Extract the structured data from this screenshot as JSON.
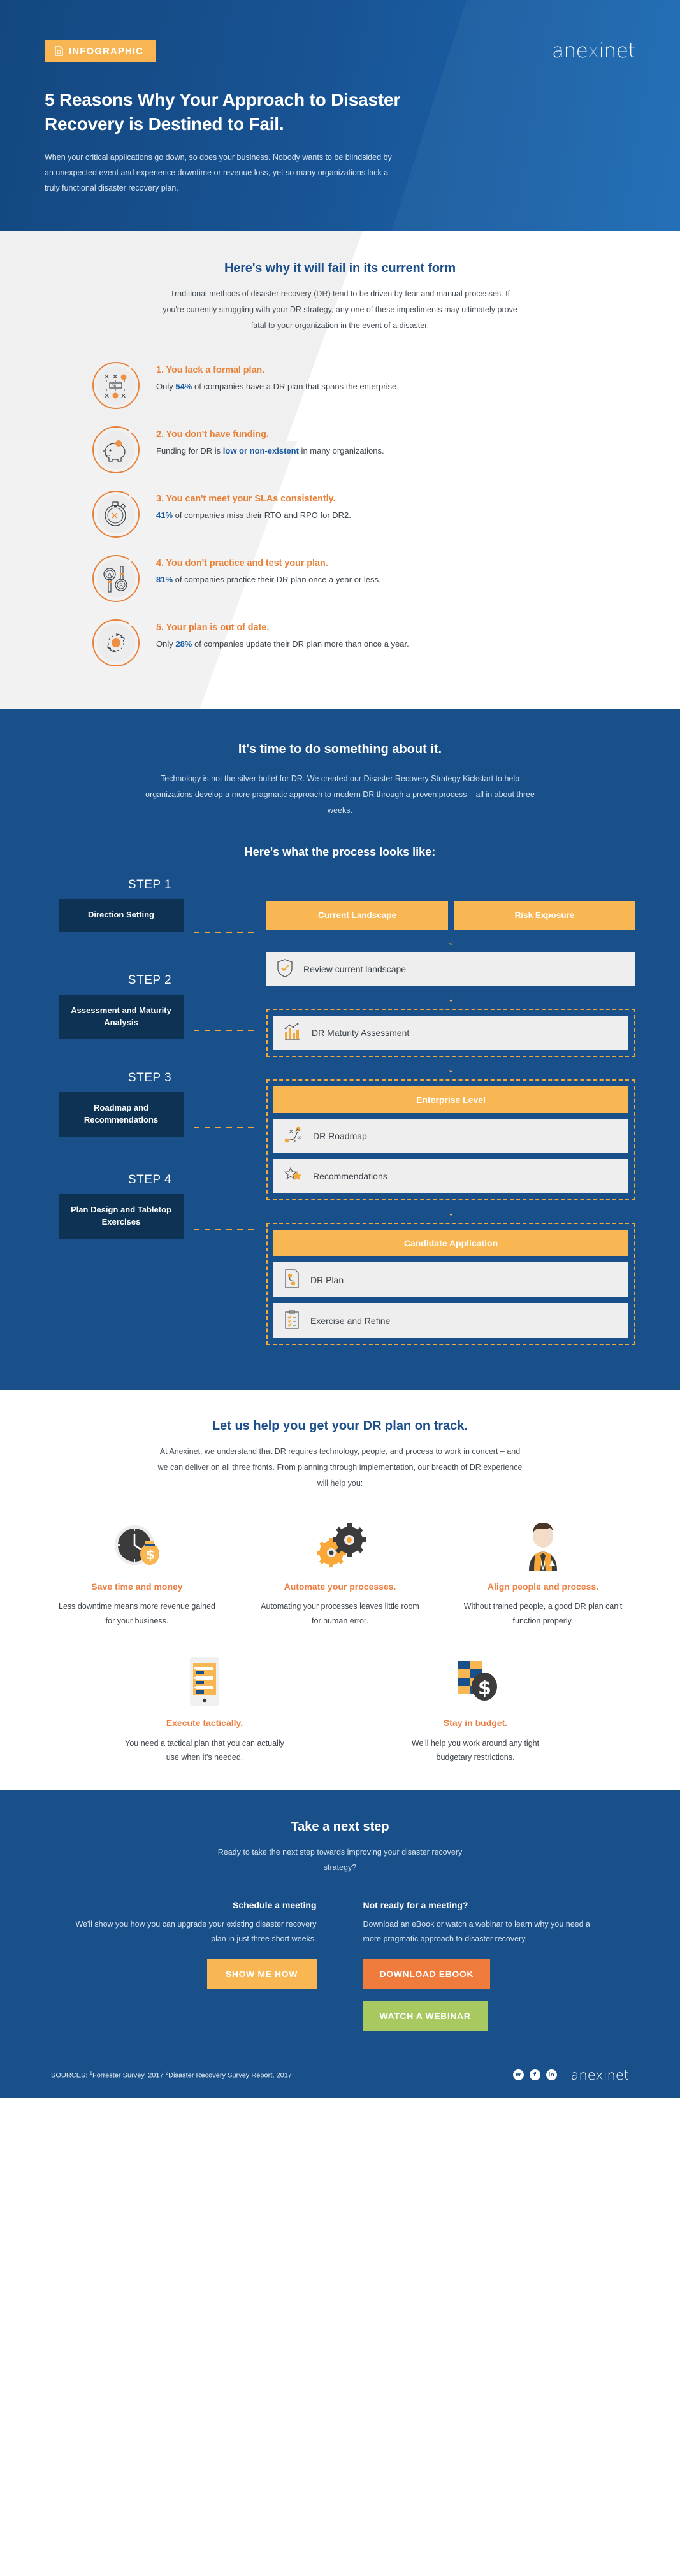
{
  "hero": {
    "badge_label": "INFOGRAPHIC",
    "badge_icon": "document-icon",
    "logo": "anexinet",
    "headline": "5 Reasons Why Your Approach to Disaster Recovery is Destined to Fail.",
    "paragraph": "When your critical applications go down, so does your business. Nobody wants to be blindsided by an unexpected event and experience downtime or revenue loss, yet so many organizations lack a truly functional disaster recovery plan."
  },
  "why": {
    "heading": "Here's why it will fail in its current form",
    "lede": "Traditional methods of disaster recovery (DR) tend to be driven by fear and manual processes. If you're currently struggling with your DR strategy, any one of these impediments may ultimately prove fatal to your organization in the event of a disaster.",
    "reasons": [
      {
        "title": "1. You lack a formal plan.",
        "body_pre": "Only ",
        "stat": "54%",
        "body_post": " of companies have a DR plan that spans the enterprise.",
        "icon": "strategy-board-icon"
      },
      {
        "title": "2. You don't have funding.",
        "body_pre": "Funding for DR is ",
        "stat": "low or non-existent",
        "body_post": " in many organizations.",
        "icon": "piggy-bank-icon"
      },
      {
        "title": "3. You can't meet your SLAs consistently.",
        "body_pre": "",
        "stat": "41%",
        "body_post": " of companies miss their RTO and RPO for DR2.",
        "icon": "stopwatch-icon"
      },
      {
        "title": "4. You don't practice and test your plan.",
        "body_pre": "",
        "stat": "81%",
        "body_post": " of companies practice their DR plan once a year or less.",
        "icon": "ab-test-icon"
      },
      {
        "title": "5. Your plan is out of date.",
        "body_pre": "Only ",
        "stat": "28%",
        "body_post": " of companies update their DR plan more than once a year.",
        "icon": "refresh-cycle-icon"
      }
    ]
  },
  "process": {
    "heading": "It's time to do something about it.",
    "lede": "Technology is not the silver bullet for DR. We created our Disaster Recovery Strategy Kickstart to help organizations develop a more pragmatic approach to modern DR through a proven process – all in about three weeks.",
    "subheading": "Here's what the process looks like:",
    "steps": [
      {
        "label": "STEP 1",
        "box": "Direction Setting"
      },
      {
        "label": "STEP 2",
        "box": "Assessment and Maturity Analysis"
      },
      {
        "label": "STEP 3",
        "box": "Roadmap and Recommendations"
      },
      {
        "label": "STEP 4",
        "box": "Plan Design and Tabletop Exercises"
      }
    ],
    "flow": {
      "s1_cell_a": "Current Landscape",
      "s1_cell_b": "Risk Exposure",
      "s1_card": "Review current landscape",
      "s1_card_icon": "shield-check-icon",
      "s2_card": "DR Maturity Assessment",
      "s2_card_icon": "bar-chart-icon",
      "s3_banner": "Enterprise Level",
      "s3_card_a": "DR Roadmap",
      "s3_card_a_icon": "roadmap-icon",
      "s3_card_b": "Recommendations",
      "s3_card_b_icon": "stars-icon",
      "s4_banner": "Candidate Application",
      "s4_card_a": "DR Plan",
      "s4_card_a_icon": "plan-document-icon",
      "s4_card_b": "Exercise and Refine",
      "s4_card_b_icon": "checklist-icon"
    }
  },
  "help": {
    "heading": "Let us help you get your DR plan on track.",
    "lede": "At Anexinet, we understand that DR requires technology, people, and process to work in concert – and we can deliver on all three fronts. From planning through implementation, our breadth of DR experience will help you:",
    "benefits_row1": [
      {
        "title": "Save time and money",
        "body": "Less downtime means more revenue gained for your business.",
        "icon": "clock-money-icon"
      },
      {
        "title": "Automate your processes.",
        "body": "Automating your processes leaves little room for human error.",
        "icon": "gears-icon"
      },
      {
        "title": "Align people and process.",
        "body": "Without trained people, a good DR plan can't function properly.",
        "icon": "businessman-icon"
      }
    ],
    "benefits_row2": [
      {
        "title": "Execute tactically.",
        "body": "You need a tactical plan that you can actually use when it's needed.",
        "icon": "tablet-checklist-icon"
      },
      {
        "title": "Stay in budget.",
        "body": "We'll help you work around any tight budgetary restrictions.",
        "icon": "money-coin-icon"
      }
    ]
  },
  "cta": {
    "heading": "Take a next step",
    "lede": "Ready to take the next step towards improving your disaster recovery strategy?",
    "left": {
      "title": "Schedule a meeting",
      "body": "We'll show you how you can upgrade your existing disaster recovery plan in just three short weeks.",
      "button": "SHOW ME HOW"
    },
    "right": {
      "title": "Not ready for a meeting?",
      "body": "Download an eBook or watch a webinar to learn why you need a more pragmatic approach to disaster recovery.",
      "button_primary": "DOWNLOAD EBOOK",
      "button_secondary": "WATCH A WEBINAR"
    }
  },
  "footer": {
    "sources_label": "SOURCES: ",
    "source1_sup": "1",
    "source1": "Forrester Survey, 2017 ",
    "source2_sup": "2",
    "source2": "Disaster Recovery Survey Report, 2017",
    "social": [
      "twitter-icon",
      "facebook-icon",
      "linkedin-icon"
    ],
    "logo": "anexinet"
  },
  "colors": {
    "brand_blue": "#1a5089",
    "dark_blue": "#0e3254",
    "heading_blue": "#1c4f8b",
    "orange": "#e8823a",
    "amber": "#f9b754",
    "green": "#a8c95f",
    "cta_orange": "#ef7c3c"
  }
}
